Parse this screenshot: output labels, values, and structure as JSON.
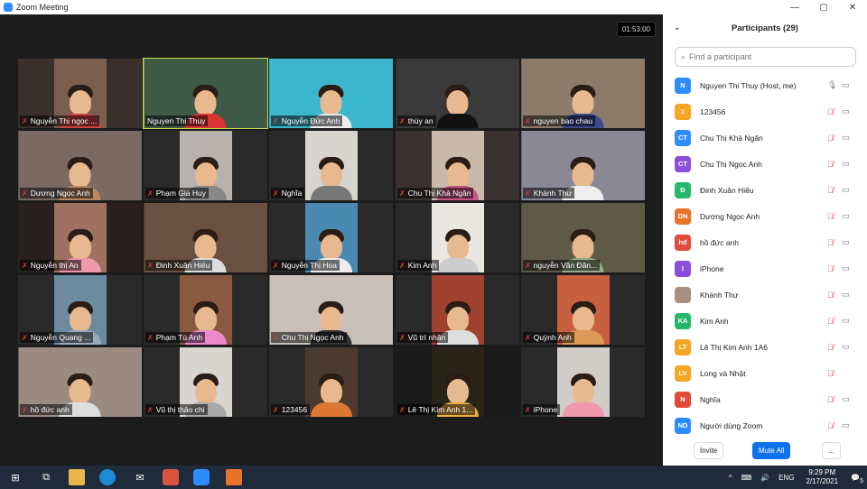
{
  "window": {
    "title": "Zoom Meeting",
    "controls": [
      "—",
      "▢",
      "✕"
    ]
  },
  "gallery": {
    "timer": "01:53:00",
    "tiles": [
      {
        "name": "Nguyễn Thị ngọc ...",
        "bg": "#3a2f2a",
        "vbg": "#7a5e4e",
        "body": "#c44"
      },
      {
        "name": "Nguyen Thi Thuy",
        "bg": "#334435",
        "vbg": "#3f5a45",
        "body": "#d33",
        "active": true,
        "wide": true
      },
      {
        "name": "Nguyễn Đức Anh",
        "bg": "#2aa0b8",
        "vbg": "#3bb6cc",
        "body": "#eee",
        "wide": true
      },
      {
        "name": "thùy an",
        "bg": "#222",
        "vbg": "#3a3a3a",
        "body": "#111",
        "wide": true
      },
      {
        "name": "nguyen bao chau",
        "bg": "#5a4a3a",
        "vbg": "#8c7b6a",
        "body": "#3a4a8c",
        "wide": true
      },
      {
        "name": "Dương Ngọc Anh",
        "bg": "#4a3b35",
        "vbg": "#7a6a62",
        "body": "#b86",
        "wide": true
      },
      {
        "name": "Phạm Gia Huy",
        "bg": "#2a2a2a",
        "vbg": "#b8b2ae",
        "body": "#888"
      },
      {
        "name": "Nghĩa",
        "bg": "#2a2a2a",
        "vbg": "#d8d4cf",
        "body": "#777"
      },
      {
        "name": "Chu Thị Khả Ngân",
        "bg": "#3a3230",
        "vbg": "#c9b9aa",
        "body": "#c58"
      },
      {
        "name": "Khánh Thư",
        "bg": "#4a4a55",
        "vbg": "#8a8895",
        "body": "#eee",
        "wide": true
      },
      {
        "name": "Nguyễn thị An",
        "bg": "#2a2020",
        "vbg": "#a07060",
        "body": "#e9a"
      },
      {
        "name": "Đinh Xuân Hiếu",
        "bg": "#2a2a2a",
        "vbg": "#6a5040",
        "body": "#ddd",
        "wide": true
      },
      {
        "name": "Nguyễn Thị Hoa",
        "bg": "#2a2a2a",
        "vbg": "#4a8ab0",
        "body": "#eee"
      },
      {
        "name": "Kim Anh",
        "bg": "#2a2a2a",
        "vbg": "#eae6e0",
        "body": "#ccc"
      },
      {
        "name": "nguyễn Văn Đăn...",
        "bg": "#3a3a2a",
        "vbg": "#5e5a48",
        "body": "#9a8",
        "wide": true
      },
      {
        "name": "Nguyễn Quang ...",
        "bg": "#2a2a2a",
        "vbg": "#6c8aa0",
        "body": "#9ab"
      },
      {
        "name": "Phạm Tú Anh",
        "bg": "#2a2a2a",
        "vbg": "#8a5a40",
        "body": "#e8c"
      },
      {
        "name": "Chu Thị Ngọc Anh",
        "bg": "#2a2a2a",
        "vbg": "#c8c0b8",
        "body": "#333",
        "wide": true
      },
      {
        "name": "Vũ trí nhân",
        "bg": "#2a2a2a",
        "vbg": "#a04030",
        "body": "#ddd"
      },
      {
        "name": "Quỳnh Anh",
        "bg": "#2a2a2a",
        "vbg": "#c86040",
        "body": "#d95"
      },
      {
        "name": "hồ đức anh",
        "bg": "#2a2a2a",
        "vbg": "#9a8a80",
        "body": "#ddd",
        "wide": true
      },
      {
        "name": "Vũ thị thảo chi",
        "bg": "#2a2a2a",
        "vbg": "#d8d4d0",
        "body": "#aaa"
      },
      {
        "name": "123456",
        "bg": "#2a2a2a",
        "vbg": "#4a3a30",
        "body": "#d73"
      },
      {
        "name": "Lê Thị Kim Anh 1...",
        "bg": "#1a1a1a",
        "vbg": "#2a2418",
        "body": "#e9b040"
      },
      {
        "name": "iPhone",
        "bg": "#2a2a2a",
        "vbg": "#d0ccc8",
        "body": "#e9a"
      }
    ]
  },
  "panel": {
    "title": "Participants (29)",
    "search_placeholder": "Find a participant",
    "participants": [
      {
        "initials": "N",
        "color": "#2d8cff",
        "name": "Nguyen Thi Thuy (Host, me)",
        "muted": false
      },
      {
        "initials": "1",
        "color": "#f5a623",
        "name": "123456",
        "muted": true
      },
      {
        "initials": "CT",
        "color": "#2d8cff",
        "name": "Chu Thị Khả Ngân",
        "muted": true
      },
      {
        "initials": "CT",
        "color": "#8a4fd8",
        "name": "Chu Thị Ngọc Anh",
        "muted": true
      },
      {
        "initials": "Đ",
        "color": "#26b86a",
        "name": "Đinh Xuân Hiếu",
        "muted": true
      },
      {
        "initials": "DN",
        "color": "#e8742a",
        "name": "Dương Ngọc Anh",
        "muted": true
      },
      {
        "initials": "hđ",
        "color": "#e04b3b",
        "name": "hồ đức anh",
        "muted": true
      },
      {
        "initials": "I",
        "color": "#8a4fd8",
        "name": "iPhone",
        "muted": true
      },
      {
        "initials": "",
        "color": "#a89080",
        "name": "Khánh Thư",
        "muted": true
      },
      {
        "initials": "KA",
        "color": "#26b86a",
        "name": "Kim Anh",
        "muted": true
      },
      {
        "initials": "LT",
        "color": "#f5a623",
        "name": "Lê Thị Kim Anh 1A6",
        "muted": true
      },
      {
        "initials": "LV",
        "color": "#f5a623",
        "name": "Long và Nhật",
        "muted": true,
        "nocam": true
      },
      {
        "initials": "N",
        "color": "#e04b3b",
        "name": "Nghĩa",
        "muted": true
      },
      {
        "initials": "ND",
        "color": "#2d8cff",
        "name": "Người dùng Zoom",
        "muted": true
      }
    ],
    "buttons": {
      "invite": "Invite",
      "mute_all": "Mute All",
      "more": "..."
    }
  },
  "taskbar": {
    "lang": "ENG",
    "time": "9:29 PM",
    "date": "2/17/2021",
    "notif_count": "5"
  }
}
